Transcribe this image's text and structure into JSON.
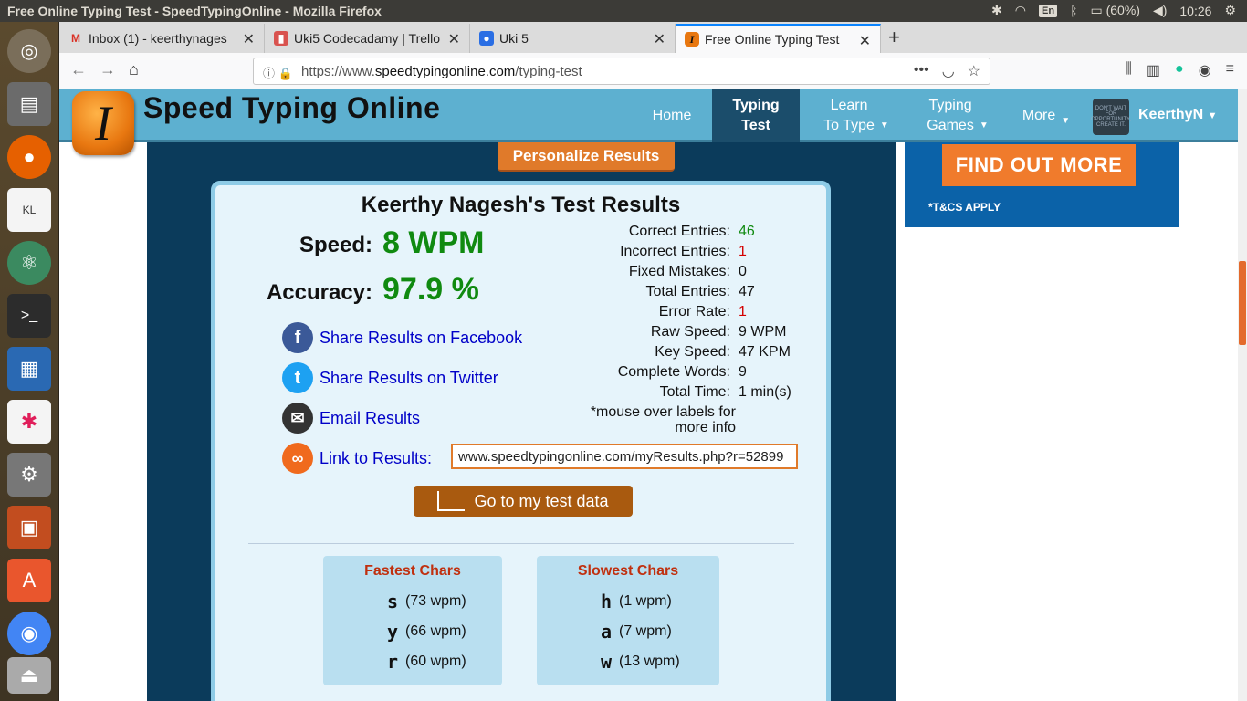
{
  "system_bar": {
    "title": "Free Online Typing Test - SpeedTypingOnline - Mozilla Firefox",
    "lang": "En",
    "battery": "(60%)",
    "time": "10:26"
  },
  "tabs": [
    {
      "label": "Inbox (1) - keerthynages",
      "icon": "gmail-icon"
    },
    {
      "label": "Uki5 Codecadamy | Trello",
      "icon": "trello-icon"
    },
    {
      "label": "Uki 5",
      "icon": "person-icon"
    },
    {
      "label": "Free Online Typing Test",
      "icon": "speedtyping-icon"
    }
  ],
  "url": {
    "prefix": "https://www.",
    "domain": "speedtypingonline.com",
    "path": "/typing-test"
  },
  "site": {
    "name": "Speed Typing Online",
    "logo_letter": "I",
    "nav": {
      "home": "Home",
      "typing_test_1": "Typing",
      "typing_test_2": "Test",
      "learn_1": "Learn",
      "learn_2": "To Type",
      "games_1": "Typing",
      "games_2": "Games",
      "more": "More",
      "user": "KeerthyN"
    },
    "avatar_text": "DON'T WAIT FOR OPPORTUNITY, CREATE IT."
  },
  "results": {
    "personalize_label": "Personalize Results",
    "title": "Keerthy Nagesh's Test Results",
    "speed_label": "Speed:",
    "speed_value": "8 WPM",
    "accuracy_label": "Accuracy:",
    "accuracy_value": "97.9 %",
    "stats": [
      {
        "label": "Correct Entries:",
        "value": "46",
        "color": "#108a10"
      },
      {
        "label": "Incorrect Entries:",
        "value": "1",
        "color": "#d40000"
      },
      {
        "label": "Fixed Mistakes:",
        "value": "0",
        "color": "#111111"
      },
      {
        "label": "Total Entries:",
        "value": "47",
        "color": "#111111"
      },
      {
        "label": "Error Rate:",
        "value": "1",
        "color": "#d40000"
      },
      {
        "label": "Raw Speed:",
        "value": "9 WPM",
        "color": "#111111"
      },
      {
        "label": "Key Speed:",
        "value": "47 KPM",
        "color": "#111111"
      },
      {
        "label": "Complete Words:",
        "value": "9",
        "color": "#111111"
      },
      {
        "label": "Total Time:",
        "value": "1 min(s)",
        "color": "#111111"
      }
    ],
    "mouse_note_1": "*mouse over labels for",
    "mouse_note_2": "more info",
    "share_facebook": "Share Results on Facebook",
    "share_twitter": "Share Results on Twitter",
    "email": "Email Results",
    "link_label": "Link to Results:",
    "link_value": "www.speedtypingonline.com/myResults.php?r=52899",
    "go_button": "Go to my test data",
    "fastest_title": "Fastest Chars",
    "fastest": [
      {
        "ch": "s",
        "speed": "(73 wpm)"
      },
      {
        "ch": "y",
        "speed": "(66 wpm)"
      },
      {
        "ch": "r",
        "speed": "(60 wpm)"
      }
    ],
    "slowest_title": "Slowest Chars",
    "slowest": [
      {
        "ch": "h",
        "speed": "(1 wpm)"
      },
      {
        "ch": "a",
        "speed": "(7 wpm)"
      },
      {
        "ch": "w",
        "speed": "(13 wpm)"
      }
    ]
  },
  "ad": {
    "button": "FIND OUT MORE",
    "terms": "*T&CS APPLY"
  }
}
